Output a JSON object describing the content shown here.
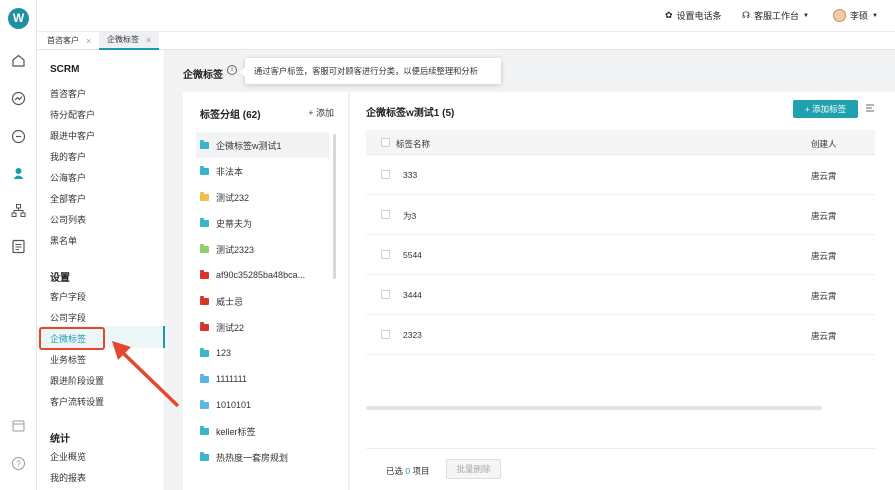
{
  "topbar": {
    "phone_settings": "设置电话条",
    "workbench": "客服工作台",
    "user": "李硕"
  },
  "tabs": [
    {
      "label": "首咨客户"
    },
    {
      "label": "企微标签"
    }
  ],
  "sidebar": {
    "scrm_title": "SCRM",
    "scrm_items": [
      "首咨客户",
      "待分配客户",
      "跟进中客户",
      "我的客户",
      "公海客户",
      "全部客户",
      "公司列表",
      "黑名单"
    ],
    "settings_title": "设置",
    "settings_items": [
      "客户字段",
      "公司字段",
      "企微标签",
      "业务标签",
      "跟进阶段设置",
      "客户流转设置"
    ],
    "stats_title": "统计",
    "stats_items": [
      "企业概览",
      "我的报表"
    ],
    "active_item": "企微标签"
  },
  "page": {
    "title": "企微标签",
    "tooltip": "通过客户标签，客服可对顾客进行分类，以便后续整理和分析"
  },
  "groups": {
    "title": "标签分组 (62)",
    "add_label": "+ 添加",
    "items": [
      {
        "name": "企微标签w测试1",
        "color": "#3ab4c8"
      },
      {
        "name": "非法本",
        "color": "#3ab4c8"
      },
      {
        "name": "测试232",
        "color": "#f2bf4d"
      },
      {
        "name": "史蒂夫为",
        "color": "#3ab4c8"
      },
      {
        "name": "测试2323",
        "color": "#8fd06b"
      },
      {
        "name": "af90c35285ba48bca...",
        "color": "#d9352b"
      },
      {
        "name": "威士忌",
        "color": "#d9352b"
      },
      {
        "name": "测试22",
        "color": "#d9352b"
      },
      {
        "name": "123",
        "color": "#3ab4c8"
      },
      {
        "name": "1111111",
        "color": "#5bb4e6"
      },
      {
        "name": "1010101",
        "color": "#5bb4e6"
      },
      {
        "name": "keller标签",
        "color": "#3ab4c8"
      },
      {
        "name": "热热度一套房规划",
        "color": "#3ab4c8"
      }
    ]
  },
  "tags": {
    "title": "企微标签w测试1 (5)",
    "add_button": "+ 添加标签",
    "columns": {
      "name": "标签名称",
      "creator": "创建人"
    },
    "rows": [
      {
        "name": "333",
        "creator": "唐云霄"
      },
      {
        "name": "为3",
        "creator": "唐云霄"
      },
      {
        "name": "5544",
        "creator": "唐云霄"
      },
      {
        "name": "3444",
        "creator": "唐云霄"
      },
      {
        "name": "2323",
        "creator": "唐云霄"
      }
    ]
  },
  "footer": {
    "selected_prefix": "已选",
    "selected_count": "0",
    "selected_suffix": "项目",
    "batch_delete": "批量删除"
  },
  "colors": {
    "accent": "#1fa1af",
    "highlight": "#e4462e"
  }
}
